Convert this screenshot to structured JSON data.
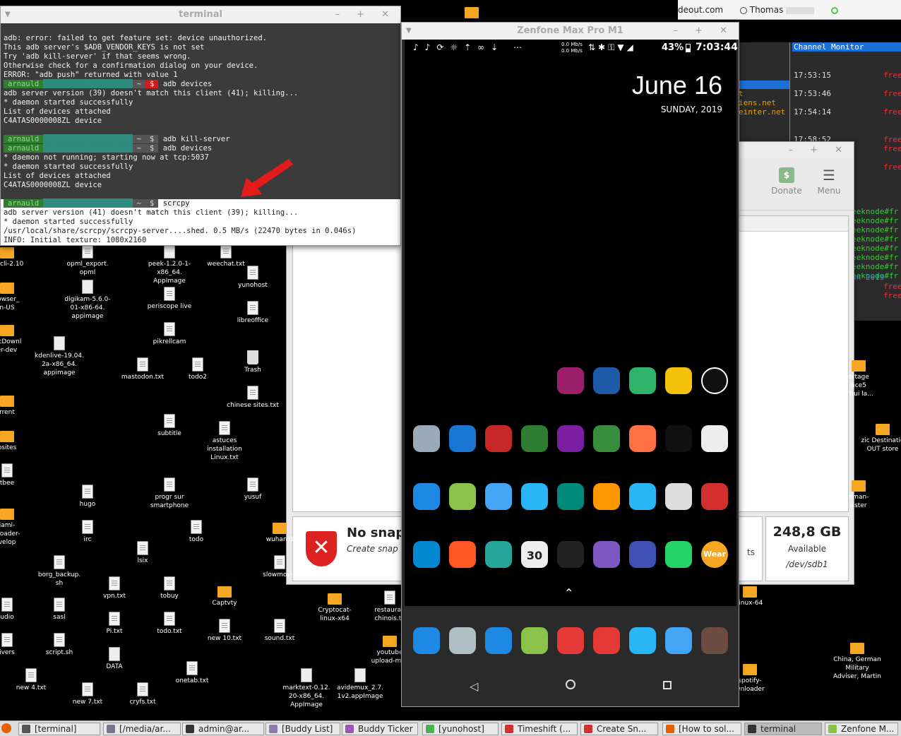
{
  "top_bar": {
    "fragment": "deout.com",
    "user": "Thomas"
  },
  "desktop_icons": [
    {
      "label": "opml_export.\nopml",
      "kind": "file"
    },
    {
      "label": "peek-1.2.0-1-\nx86_64.\nAppImage",
      "kind": "gear"
    },
    {
      "label": "weechat.txt",
      "kind": "file"
    },
    {
      "label": "xt_cli-2.10",
      "kind": "folder"
    },
    {
      "label": "yunohost",
      "kind": "file"
    },
    {
      "label": "rowser_\nn-US",
      "kind": "folder"
    },
    {
      "label": "digikam-5.6.0-\n01-x86-64.\nappimage",
      "kind": "gear"
    },
    {
      "label": "periscope live",
      "kind": "file"
    },
    {
      "label": "libreoffice",
      "kind": "file"
    },
    {
      "label": "PicDownl\ner-dev",
      "kind": "folder"
    },
    {
      "label": "pikrellcam",
      "kind": "file"
    },
    {
      "label": "kdenlive-19.04.\n2a-x86_64.\nappimage",
      "kind": "gear"
    },
    {
      "label": "Trash",
      "kind": "trash"
    },
    {
      "label": "mastodon.txt",
      "kind": "file"
    },
    {
      "label": "todo2",
      "kind": "file"
    },
    {
      "label": "rrent",
      "kind": "folder"
    },
    {
      "label": "chinese sites.txt",
      "kind": "file"
    },
    {
      "label": "subtitle",
      "kind": "file"
    },
    {
      "label": "astuces\ninstallation\nLinux.txt",
      "kind": "file"
    },
    {
      "label": "bsites",
      "kind": "folder"
    },
    {
      "label": "tbee",
      "kind": "file"
    },
    {
      "label": "progr sur\nsmartphone",
      "kind": "file"
    },
    {
      "label": "yusuf",
      "kind": "file"
    },
    {
      "label": "hugo",
      "kind": "file"
    },
    {
      "label": "iami-\nnloader-\nvelop",
      "kind": "folder"
    },
    {
      "label": "irc",
      "kind": "file"
    },
    {
      "label": "todo",
      "kind": "file"
    },
    {
      "label": "wuhan d",
      "kind": "folder"
    },
    {
      "label": "lsix",
      "kind": "file"
    },
    {
      "label": "borg_backup.\nsh",
      "kind": "file"
    },
    {
      "label": "slowmovie",
      "kind": "file"
    },
    {
      "label": "vpn.txt",
      "kind": "file"
    },
    {
      "label": "tobuy",
      "kind": "file"
    },
    {
      "label": "Captvty",
      "kind": "folder"
    },
    {
      "label": "Cryptocat-\nlinux-x64",
      "kind": "folder"
    },
    {
      "label": "restauran\nchinois.tx",
      "kind": "file"
    },
    {
      "label": "udio",
      "kind": "file"
    },
    {
      "label": "sasl",
      "kind": "file"
    },
    {
      "label": "Pi.txt",
      "kind": "file"
    },
    {
      "label": "todo.txt",
      "kind": "file"
    },
    {
      "label": "new 10.txt",
      "kind": "file"
    },
    {
      "label": "sound.txt",
      "kind": "file"
    },
    {
      "label": "ivers",
      "kind": "file"
    },
    {
      "label": "script.sh",
      "kind": "file"
    },
    {
      "label": "DATA",
      "kind": "gear"
    },
    {
      "label": "youtube\nupload-mas",
      "kind": "folder"
    },
    {
      "label": "new 4.txt",
      "kind": "file"
    },
    {
      "label": "onetab.txt",
      "kind": "file"
    },
    {
      "label": "new 7.txt",
      "kind": "file"
    },
    {
      "label": "cryfs.txt",
      "kind": "file"
    },
    {
      "label": "marktext-0.12.\n20-x86_64.\nAppImage",
      "kind": "gear"
    },
    {
      "label": "avidemux_2.7.\n1v2.appImage",
      "kind": "gear"
    },
    {
      "label": "ortage\nnce5\nd'hui la...",
      "kind": "folder"
    },
    {
      "label": "zic Destinatio\nOUT store",
      "kind": "folder"
    },
    {
      "label": "nman-\naster",
      "kind": "folder"
    },
    {
      "label": "linux-64",
      "kind": "folder"
    },
    {
      "label": "spotify-\nwnloader",
      "kind": "folder"
    },
    {
      "label": "China, German\nMilitary\nAdviser, Martin",
      "kind": "folder"
    }
  ],
  "terminal": {
    "title": "terminal",
    "lines_top": [
      "adb: error: failed to get feature set: device unauthorized.",
      "This adb server's $ADB_VENDOR_KEYS is not set",
      "Try 'adb kill-server' if that seems wrong.",
      "Otherwise check for a confirmation dialog on your device.",
      "ERROR: \"adb push\" returned with value 1"
    ],
    "user": "arnauld",
    "tilde": "~",
    "dollar": "$",
    "cmd1": "adb devices",
    "block1": [
      "adb server version (39) doesn't match this client (41); killing...",
      "* daemon started successfully",
      "List of devices attached",
      "C4ATAS0000008ZL device"
    ],
    "cmd2": "adb kill-server",
    "cmd3": "adb devices",
    "block2": [
      "* daemon not running; starting now at tcp:5037",
      "* daemon started successfully",
      "List of devices attached",
      "C4ATAS0000008ZL device"
    ],
    "cmd4": "scrcpy",
    "block3": [
      "adb server version (41) doesn't match this client (39); killing...",
      "* daemon started successfully",
      "/usr/local/share/scrcpy/scrcpy-server....shed. 0.5 MB/s (22470 bytes in 0.046s)",
      "INFO: Initial texture: 1080x2160"
    ]
  },
  "phone_window": {
    "title": "Zenfone Max Pro M1",
    "status": {
      "net_up": "0.0 Mb/s",
      "net_down": "0.0 Mb/s",
      "battery": "43%",
      "time": "7:03:44"
    },
    "date": "June 16",
    "weekday": "SUNDAY, 2019",
    "calendar_day": "30",
    "wear_label": "Wear"
  },
  "timeshift": {
    "donate": "Donate",
    "menu": "Menu",
    "snapshot_title": "No snap",
    "snapshot_sub": "Create snap",
    "size": "248,8 GB",
    "available": "Available",
    "device": "/dev/sdb1",
    "ts_frag": "ts"
  },
  "channel_monitor": {
    "title": "Channel Monitor",
    "rows": [
      {
        "time": "17:53:15",
        "txt": "free"
      },
      {
        "time": "17:53:46",
        "txt": "free"
      },
      {
        "time": "17:54:14",
        "txt": "free"
      },
      {
        "time": "17:58:52",
        "txt": "free"
      }
    ],
    "left_frags": [
      "t",
      "iens.net",
      "einter.net"
    ],
    "green_rows": [
      "eeknode#fr",
      "eeknode#fr",
      "eeknode#fr",
      "eeknode#fr",
      "eeknode#fr",
      "eeknode#fr",
      "eeknode#fr",
      "eeknode#fr"
    ],
    "date_frag": "un 2019 -",
    "red_tail": [
      "free",
      "free"
    ]
  },
  "taskbar": {
    "items": [
      "[terminal]",
      "[/media/ar...",
      "admin@ar...",
      "[Buddy List]",
      "Buddy Ticker",
      "[yunohost]",
      "Timeshift (...",
      "Create Sn...",
      "[How to sol...",
      "terminal",
      "Zenfone M..."
    ]
  },
  "colors": {
    "prompt_green": "#2f7d2f",
    "prompt_teal": "#2e8b7e",
    "prompt_red": "#d41a1a",
    "arrow_red": "#e41b1b",
    "folder": "#f5a623"
  }
}
